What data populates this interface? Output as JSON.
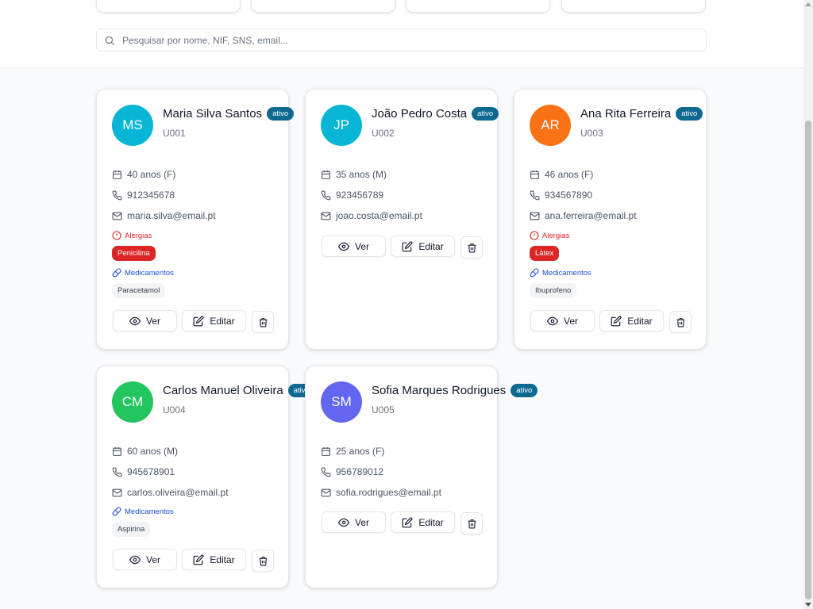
{
  "search": {
    "placeholder": "Pesquisar por nome, NIF, SNS, email..."
  },
  "colors": {
    "badge": "#0e6991",
    "allergy": "#dc2626",
    "medication": "#1d4ed8",
    "avatar_blue": "#06b6d4",
    "avatar_orange": "#f97316",
    "avatar_green": "#22c55e",
    "avatar_purple": "#6366f1"
  },
  "buttons": {
    "view": "Ver",
    "edit": "Editar"
  },
  "labels": {
    "allergies": "Alergias",
    "medications": "Medicamentos"
  },
  "patients": [
    {
      "initials": "MS",
      "name": "Maria Silva Santos",
      "status": "ativo",
      "id": "U001",
      "age": "40 anos (F)",
      "phone": "912345678",
      "email": "maria.silva@email.pt",
      "allergies": [
        "Penicilina"
      ],
      "medications": [
        "Paracetamol"
      ]
    },
    {
      "initials": "JP",
      "name": "João Pedro Costa",
      "status": "ativo",
      "id": "U002",
      "age": "35 anos (M)",
      "phone": "923456789",
      "email": "joao.costa@email.pt",
      "allergies": [],
      "medications": []
    },
    {
      "initials": "AR",
      "name": "Ana Rita Ferreira",
      "status": "ativo",
      "id": "U003",
      "age": "46 anos (F)",
      "phone": "934567890",
      "email": "ana.ferreira@email.pt",
      "allergies": [
        "Látex"
      ],
      "medications": [
        "Ibuprofeno"
      ]
    },
    {
      "initials": "CM",
      "name": "Carlos Manuel Oliveira",
      "status": "ativo",
      "id": "U004",
      "age": "60 anos (M)",
      "phone": "945678901",
      "email": "carlos.oliveira@email.pt",
      "allergies": [],
      "medications": [
        "Aspirina"
      ]
    },
    {
      "initials": "SM",
      "name": "Sofia Marques Rodrigues",
      "status": "ativo",
      "id": "U005",
      "age": "25 anos (F)",
      "phone": "956789012",
      "email": "sofia.rodrigues@email.pt",
      "allergies": [],
      "medications": []
    }
  ]
}
